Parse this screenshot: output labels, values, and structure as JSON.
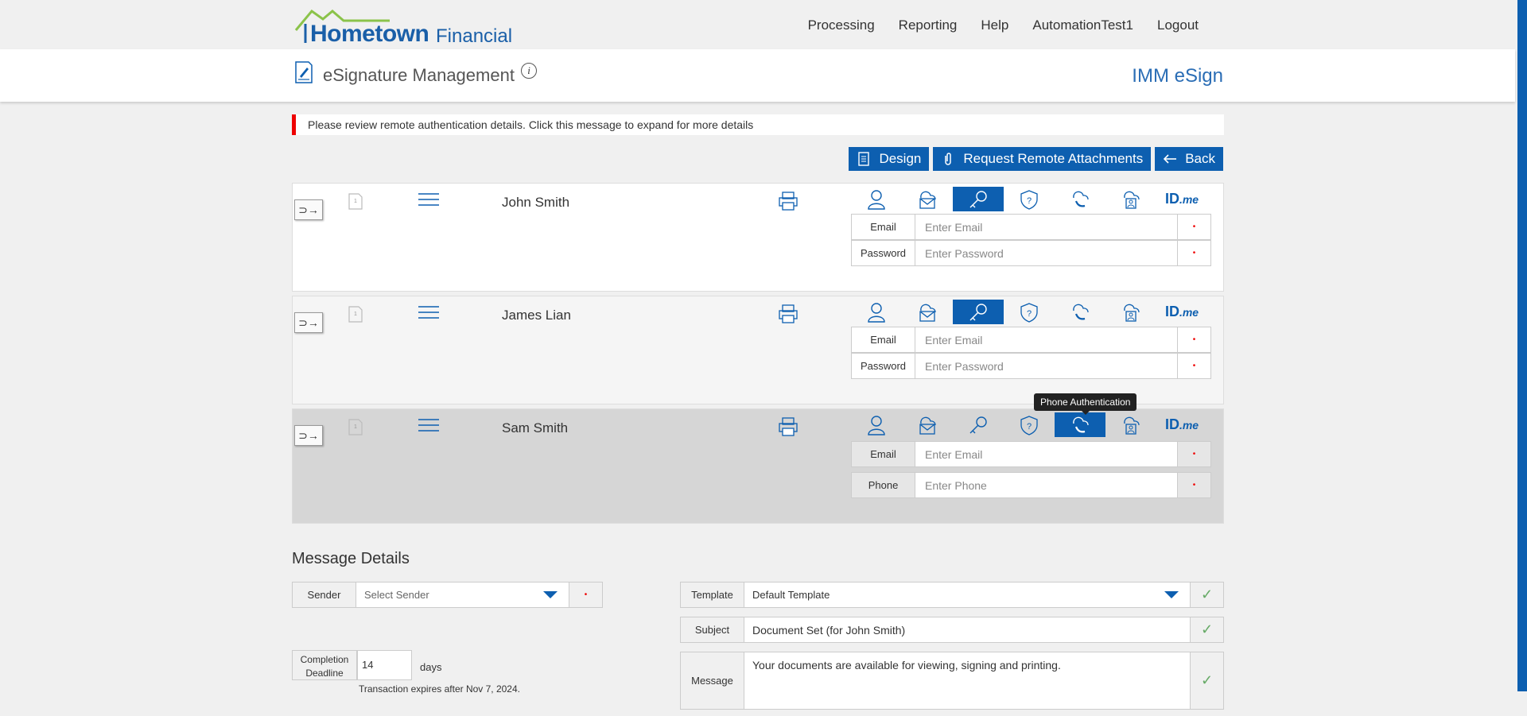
{
  "brand": {
    "name_bold": "Hometown",
    "name_light": "Financial",
    "app": "IMM eSign"
  },
  "nav": [
    "Processing",
    "Reporting",
    "Help",
    "AutomationTest1",
    "Logout"
  ],
  "page_title": "eSignature Management",
  "alert": "Please review remote authentication details. Click this message to expand for more details",
  "actions": {
    "design": "Design",
    "attachments": "Request Remote Attachments",
    "back": "Back"
  },
  "signers": [
    {
      "name": "John Smith",
      "selected_auth": "knowledge",
      "fields": [
        {
          "label": "Email",
          "placeholder": "Enter Email"
        },
        {
          "label": "Password",
          "placeholder": "Enter Password"
        }
      ]
    },
    {
      "name": "James Lian",
      "selected_auth": "knowledge",
      "fields": [
        {
          "label": "Email",
          "placeholder": "Enter Email"
        },
        {
          "label": "Password",
          "placeholder": "Enter Password"
        }
      ]
    },
    {
      "name": "Sam Smith",
      "selected_auth": "phone",
      "fields": [
        {
          "label": "Email",
          "placeholder": "Enter Email"
        },
        {
          "label": "Phone",
          "placeholder": "Enter Phone"
        }
      ]
    }
  ],
  "doc_number": "1",
  "tooltip": "Phone Authentication",
  "idme": {
    "id": "ID",
    "me": ".me"
  },
  "message_details": {
    "title": "Message Details",
    "sender_label": "Sender",
    "sender_value": "Select Sender",
    "template_label": "Template",
    "template_value": "Default Template",
    "subject_label": "Subject",
    "subject_value": "Document Set (for John Smith)",
    "message_label": "Message",
    "message_value": "Your documents are available for viewing, signing and printing.",
    "deadline_label_1": "Completion",
    "deadline_label_2": "Deadline",
    "deadline_value": "14",
    "days": "days",
    "expires": "Transaction expires after Nov 7, 2024."
  },
  "colors": {
    "accent": "#0d5fb0",
    "alert": "#e00000"
  }
}
